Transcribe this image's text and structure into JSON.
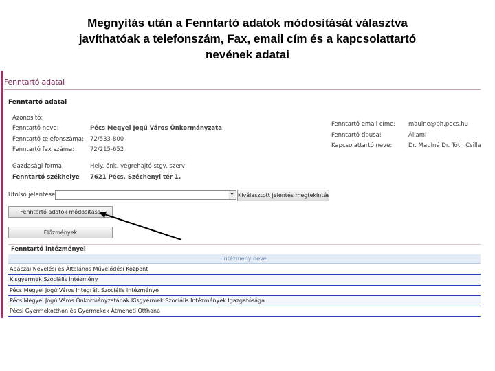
{
  "slide": {
    "title_line1": "Megnyitás után a Fenntartó adatok módosítását választva",
    "title_line2": "javíthatóak a telefonszám, Fax, email cím és a kapcsolattartó",
    "title_line3": "nevének adatai"
  },
  "app": {
    "header_title": "Fenntartó adatai",
    "section_title": "Fenntartó adatai",
    "fields_left": [
      {
        "label": "Azonosító:",
        "value": ""
      },
      {
        "label": "Fenntartó neve:",
        "value": "Pécs Megyei Jogú Város Önkormányzata"
      },
      {
        "label": "Fenntartó telefonszáma:",
        "value": "72/533-800"
      },
      {
        "label": "Fenntartó fax száma:",
        "value": "72/215-652"
      },
      {
        "label": "Gazdasági forma:",
        "value": "Hely. önk. végrehajtó stgv. szerv"
      },
      {
        "label": "Fenntartó székhelye",
        "value": "7621 Pécs, Széchenyi tér 1."
      }
    ],
    "fields_right": [
      {
        "label": "Fenntartó email címe:",
        "value": "maulne@ph.pecs.hu"
      },
      {
        "label": "Fenntartó típusa:",
        "value": "Állami"
      },
      {
        "label": "Kapcsolattartó neve:",
        "value": "Dr. Maulné Dr. Tóth Csilla"
      }
    ],
    "last_report_label": "Utolsó jelentések:",
    "last_report_value": "",
    "select_arrow": "▼",
    "view_report_button": "Kiválasztott jelentés megtekintése",
    "modify_button": "Fenntartó adatok módosítása",
    "history_button": "Előzmények",
    "institutions_title": "Fenntartó intézményei",
    "institutions_column": "Intézmény neve",
    "institutions": [
      "Apáczai Nevelési és Általános Művelődési Központ",
      "Kisgyermek Szociális Intézmény",
      "Pécs Megyei Jogú Város Integrált Szociális Intézménye",
      "Pécs Megyei Jogú Város Önkormányzatának Kisgyermek Szociális Intézmények Igazgatósága",
      "Pécsi Gyermekotthon és Gyermekek Átmeneti Otthona"
    ]
  }
}
